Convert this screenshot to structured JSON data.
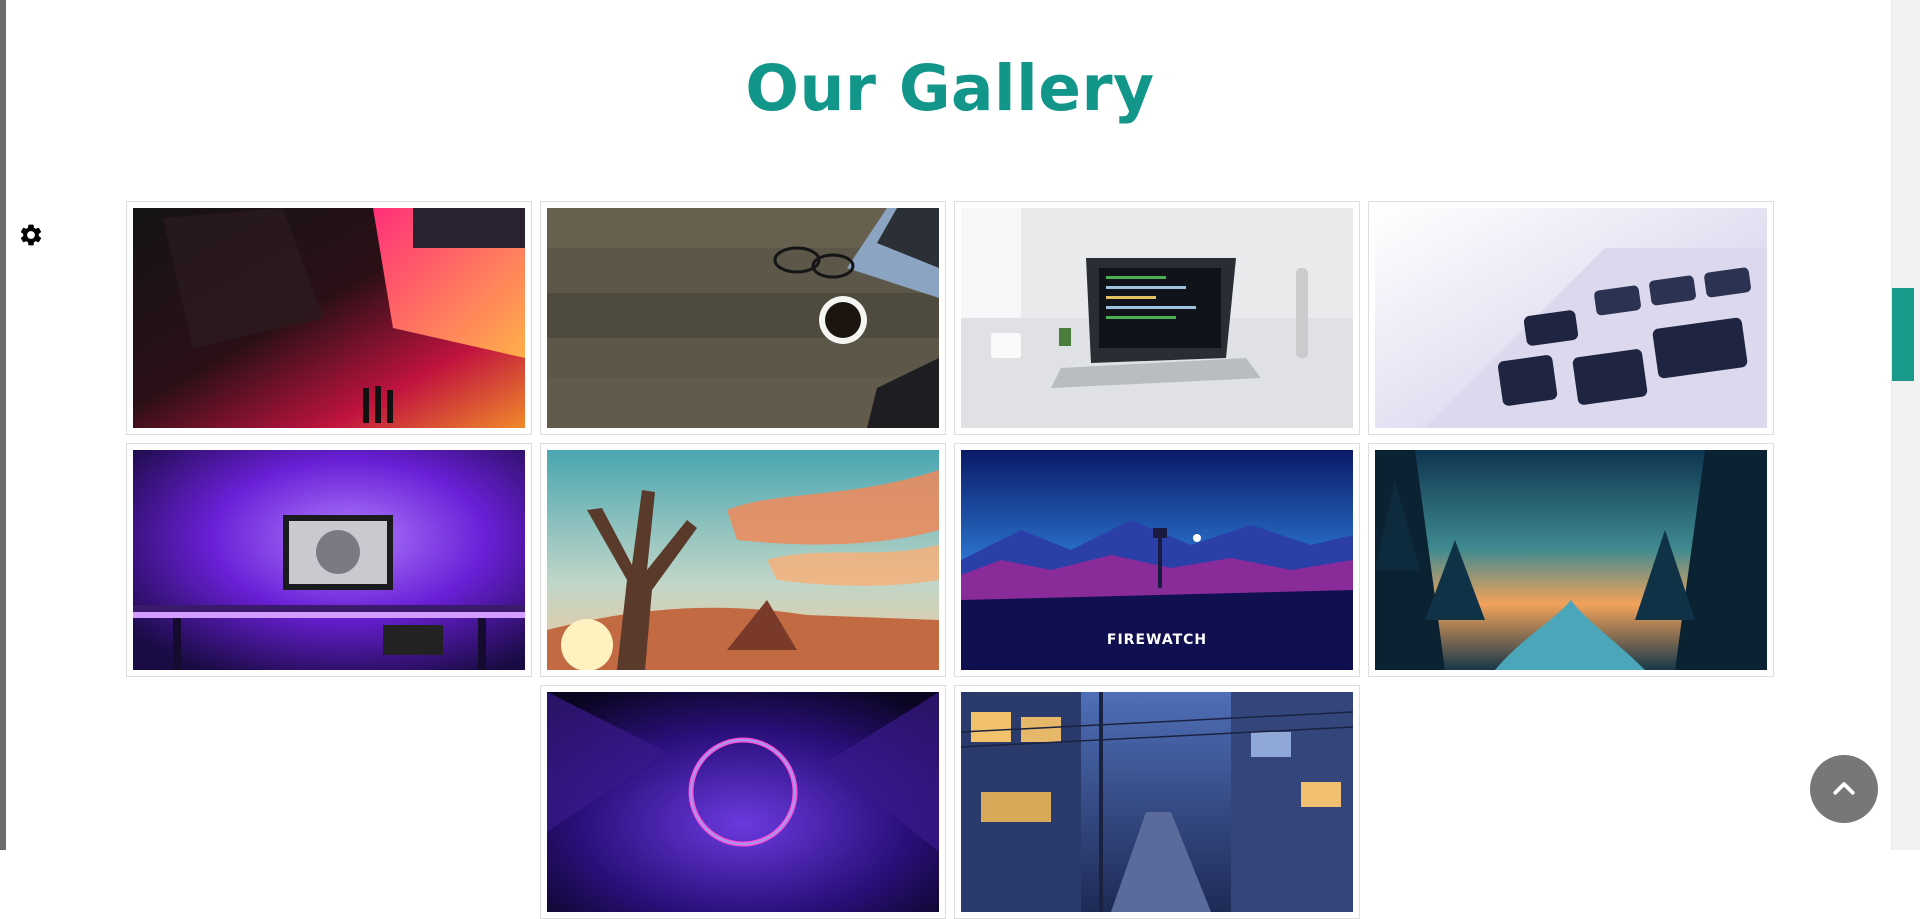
{
  "page": {
    "title": "Our Gallery"
  },
  "gallery": {
    "items": [
      {
        "name": "laptop-neon-desk"
      },
      {
        "name": "wooden-desk-coffee"
      },
      {
        "name": "white-desk-laptop-code"
      },
      {
        "name": "keyboard-closeup"
      },
      {
        "name": "purple-desk-setup"
      },
      {
        "name": "tree-sunset-painting"
      },
      {
        "name": "firewatch-wallpaper",
        "caption": "FIREWATCH"
      },
      {
        "name": "forest-river-sunset"
      },
      {
        "name": "neon-ring-tunnel"
      },
      {
        "name": "anime-street-night"
      }
    ]
  },
  "icons": {
    "settings": "gear-icon",
    "scroll_top": "chevron-up-icon"
  },
  "colors": {
    "accent": "#12968a",
    "scroll_top_bg": "#777777"
  }
}
